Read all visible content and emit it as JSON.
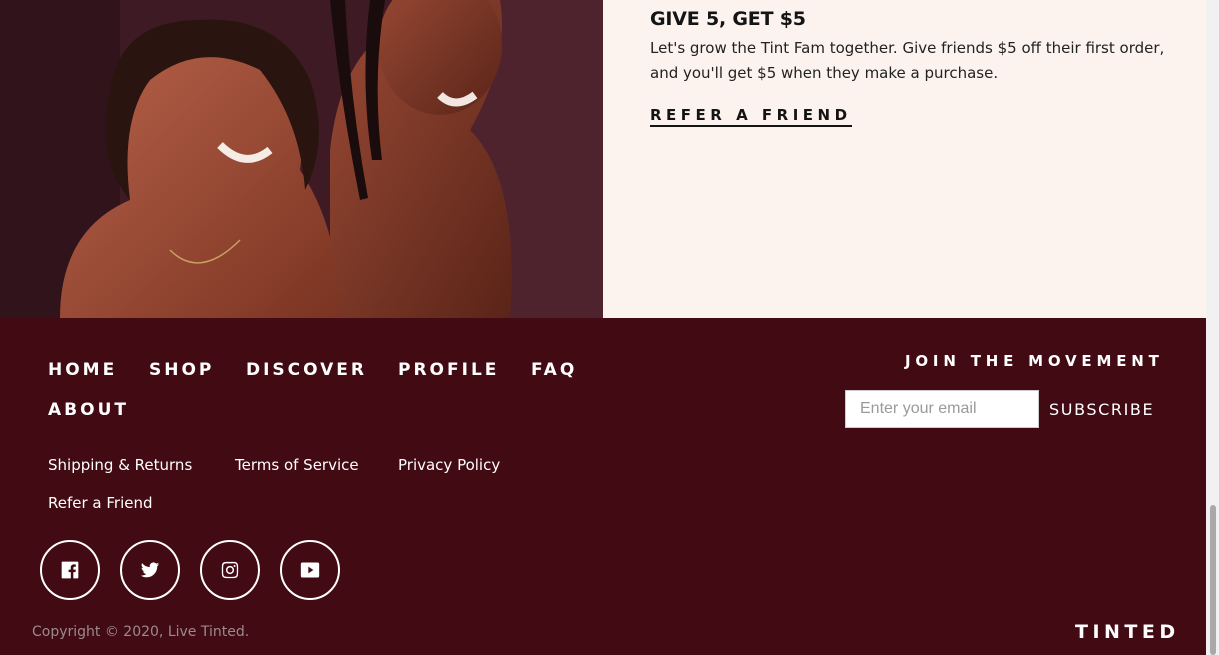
{
  "promo": {
    "title": "GIVE 5, GET $5",
    "body": "Let's grow the Tint Fam together. Give friends $5 off their first order, and you'll get $5 when they make a purchase.",
    "cta": "REFER A FRIEND"
  },
  "footer": {
    "nav": [
      "HOME",
      "SHOP",
      "DISCOVER",
      "PROFILE",
      "FAQ",
      "ABOUT"
    ],
    "links": [
      "Shipping & Returns",
      "Terms of Service",
      "Privacy Policy",
      "Refer a Friend"
    ],
    "social": [
      "facebook-icon",
      "twitter-icon",
      "instagram-icon",
      "youtube-icon"
    ],
    "newsletter": {
      "title": "JOIN THE MOVEMENT",
      "placeholder": "Enter your email",
      "button": "SUBSCRIBE"
    },
    "copyright": "Copyright © 2020, Live Tinted.",
    "logo": "TINTED"
  },
  "colors": {
    "footer_bg": "#420a12",
    "promo_bg": "#fcf3ef",
    "text_dark": "#141414"
  }
}
